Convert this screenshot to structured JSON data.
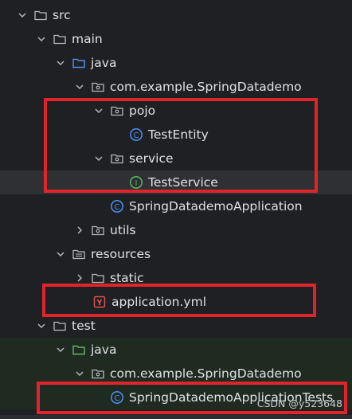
{
  "tree": {
    "items": [
      {
        "label": "src",
        "icon": "folder-icon"
      },
      {
        "label": "main",
        "icon": "folder-icon"
      },
      {
        "label": "java",
        "icon": "source-folder-icon"
      },
      {
        "label": "com.example.SpringDatademo",
        "icon": "package-icon"
      },
      {
        "label": "pojo",
        "icon": "package-icon"
      },
      {
        "label": "TestEntity",
        "icon": "class-icon"
      },
      {
        "label": "service",
        "icon": "package-icon"
      },
      {
        "label": "TestService",
        "icon": "interface-icon"
      },
      {
        "label": "SpringDatademoApplication",
        "icon": "class-icon"
      },
      {
        "label": "utils",
        "icon": "package-icon"
      },
      {
        "label": "resources",
        "icon": "resources-folder-icon"
      },
      {
        "label": "static",
        "icon": "folder-icon"
      },
      {
        "label": "application.yml",
        "icon": "yaml-file-icon"
      },
      {
        "label": "test",
        "icon": "folder-icon"
      },
      {
        "label": "java",
        "icon": "test-source-folder-icon"
      },
      {
        "label": "com.example.SpringDatademo",
        "icon": "package-icon"
      },
      {
        "label": "SpringDatademoApplicationTests",
        "icon": "class-icon"
      }
    ]
  },
  "colors": {
    "background": "#1f2023",
    "highlight": "#e0242c",
    "class_icon": "#4d8ff5",
    "interface_icon": "#5fb865",
    "source_folder": "#4d8ff5",
    "test_folder": "#5fb865",
    "yaml_icon": "#e05252"
  },
  "watermark": "CSDN @y523648"
}
